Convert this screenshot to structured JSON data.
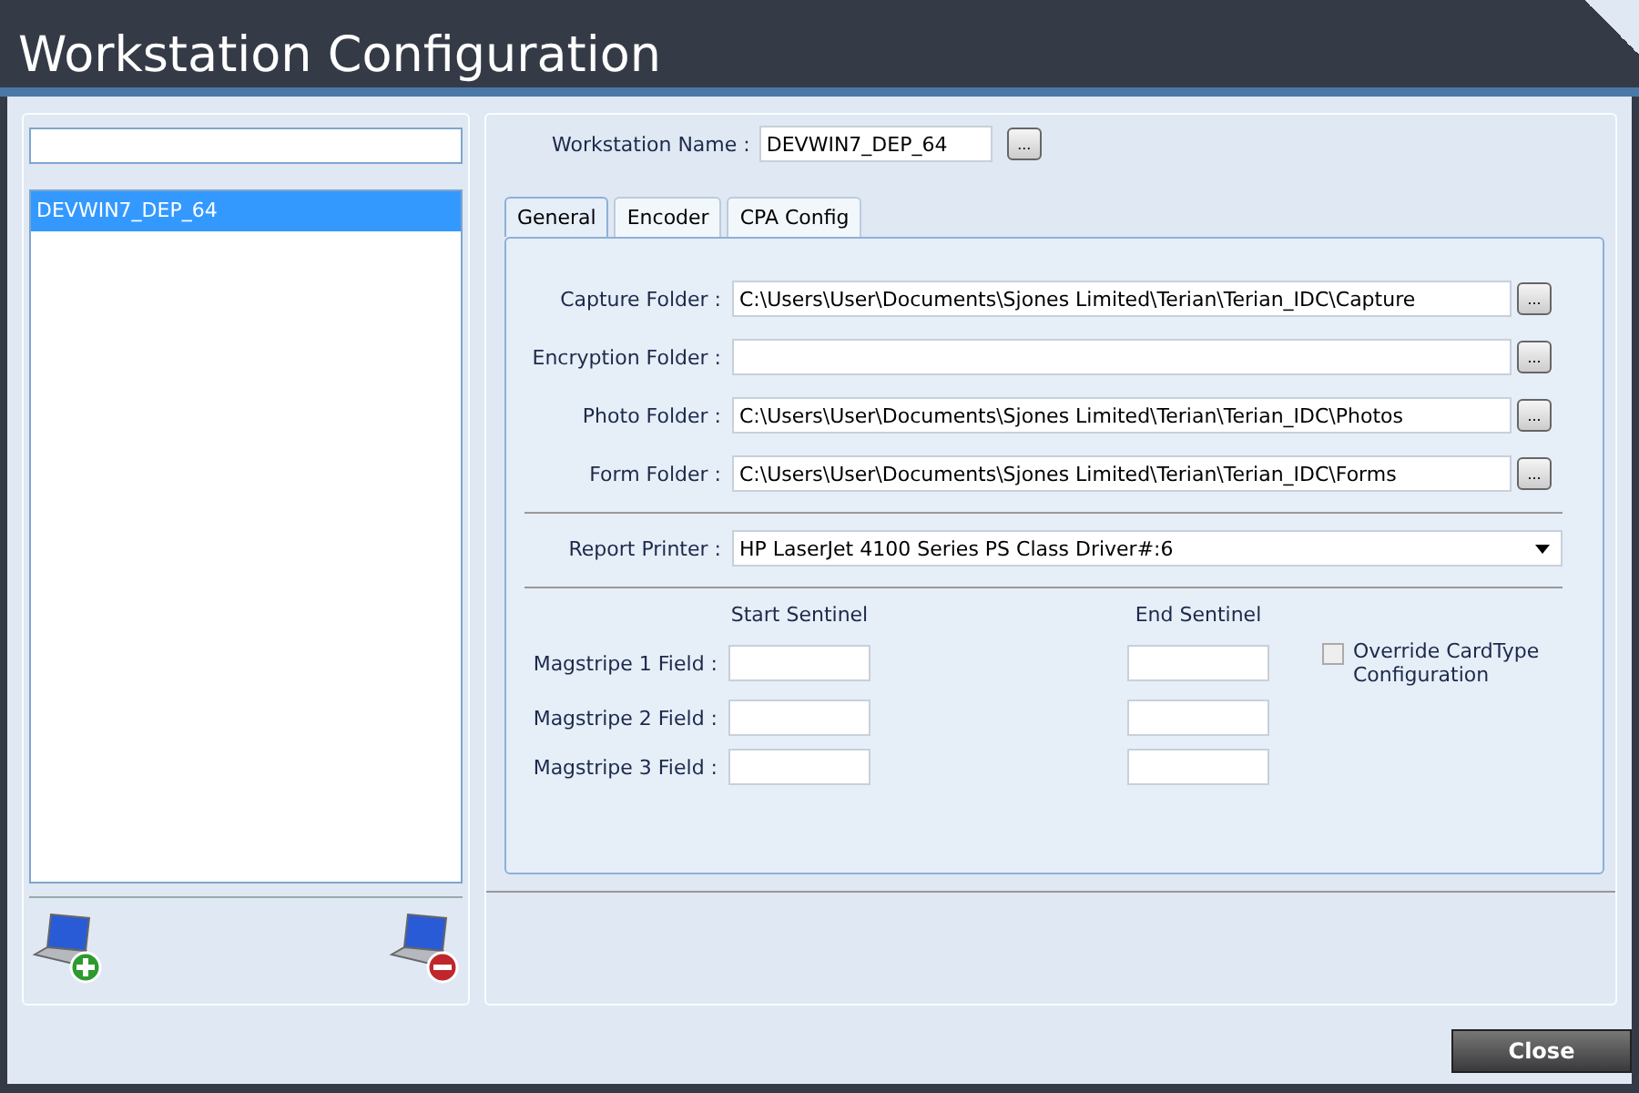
{
  "window": {
    "title": "Workstation Configuration"
  },
  "sidebar": {
    "items": [
      {
        "label": "DEVWIN7_DEP_64",
        "selected": true
      }
    ],
    "actions": [
      {
        "kind": "add"
      },
      {
        "kind": "remove"
      }
    ]
  },
  "workstation_name": {
    "label": "Workstation Name :",
    "value": "DEVWIN7_DEP_64",
    "browse": "..."
  },
  "tabs": [
    {
      "label": "General",
      "selected": true
    },
    {
      "label": "Encoder",
      "selected": false
    },
    {
      "label": "CPA Config",
      "selected": false
    }
  ],
  "folders": [
    {
      "label": "Capture Folder :",
      "value": "C:\\Users\\User\\Documents\\Sjones Limited\\Terian\\Terian_IDC\\Capture",
      "browse": "..."
    },
    {
      "label": "Encryption Folder :",
      "browse": "..."
    },
    {
      "label": "Photo Folder :",
      "value": "C:\\Users\\User\\Documents\\Sjones Limited\\Terian\\Terian_IDC\\Photos",
      "browse": "..."
    },
    {
      "label": "Form Folder :",
      "value": "C:\\Users\\User\\Documents\\Sjones Limited\\Terian\\Terian_IDC\\Forms",
      "browse": "..."
    }
  ],
  "report_printer": {
    "label": "Report Printer :",
    "value": "HP LaserJet 4100 Series PS Class Driver#:6"
  },
  "sentinels": {
    "columns": [
      "Start Sentinel",
      "End Sentinel"
    ],
    "rows": [
      {
        "label": "Magstripe 1 Field :"
      },
      {
        "label": "Magstripe 2 Field :"
      },
      {
        "label": "Magstripe 3 Field :"
      }
    ]
  },
  "override": {
    "label": "Override CardType Configuration",
    "checked": false
  },
  "buttons": [
    {
      "label": "Close"
    }
  ]
}
